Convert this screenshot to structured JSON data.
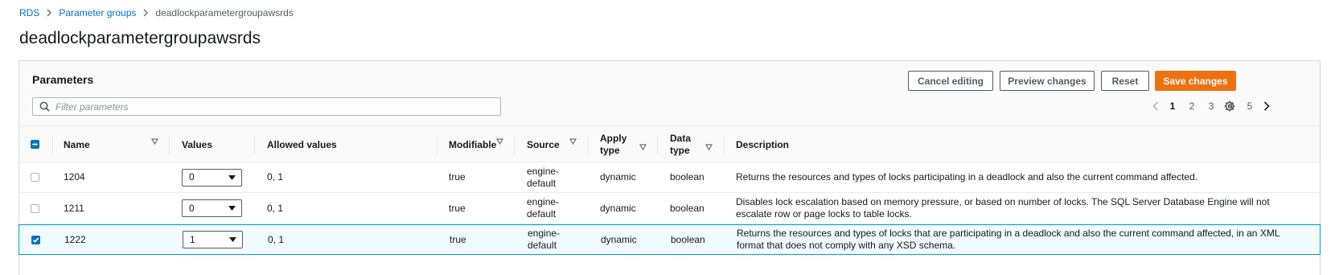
{
  "breadcrumb": {
    "items": [
      "RDS",
      "Parameter groups"
    ],
    "current": "deadlockparametergroupawsrds"
  },
  "page_title": "deadlockparametergroupawsrds",
  "panel": {
    "title": "Parameters",
    "buttons": {
      "cancel": "Cancel editing",
      "preview": "Preview changes",
      "reset": "Reset",
      "save": "Save changes"
    },
    "search_placeholder": "Filter parameters",
    "pagination": {
      "pages": [
        "1",
        "2",
        "3",
        "4",
        "5"
      ],
      "current": "1"
    }
  },
  "table": {
    "columns": {
      "name": "Name",
      "values": "Values",
      "allowed": "Allowed values",
      "modifiable": "Modifiable",
      "source": "Source",
      "apply_line1": "Apply",
      "apply_line2": "type",
      "data_line1": "Data",
      "data_line2": "type",
      "description": "Description"
    },
    "rows": [
      {
        "name": "1204",
        "value": "0",
        "allowed": "0, 1",
        "modifiable": "true",
        "source_line1": "engine-",
        "source_line2": "default",
        "apply_type": "dynamic",
        "data_type": "boolean",
        "description_line1": "Returns the resources and types of locks participating in a deadlock and also the current command affected.",
        "description_line2": ""
      },
      {
        "name": "1211",
        "value": "0",
        "allowed": "0, 1",
        "modifiable": "true",
        "source_line1": "engine-",
        "source_line2": "default",
        "apply_type": "dynamic",
        "data_type": "boolean",
        "description_line1": "Disables lock escalation based on memory pressure, or based on number of locks. The SQL Server Database Engine will not",
        "description_line2": "escalate row or page locks to table locks."
      },
      {
        "name": "1222",
        "value": "1",
        "allowed": "0, 1",
        "modifiable": "true",
        "source_line1": "engine-",
        "source_line2": "default",
        "apply_type": "dynamic",
        "data_type": "boolean",
        "description_line1": "Returns the resources and types of locks that are participating in a deadlock and also the current command affected, in an XML",
        "description_line2": "format that does not comply with any XSD schema."
      }
    ]
  },
  "colors": {
    "link": "#0073bb",
    "primary_button": "#ec7211",
    "selected_row_border": "#00a1c9",
    "selected_row_bg": "#f1faff",
    "checkbox_checked": "#0073bb"
  }
}
